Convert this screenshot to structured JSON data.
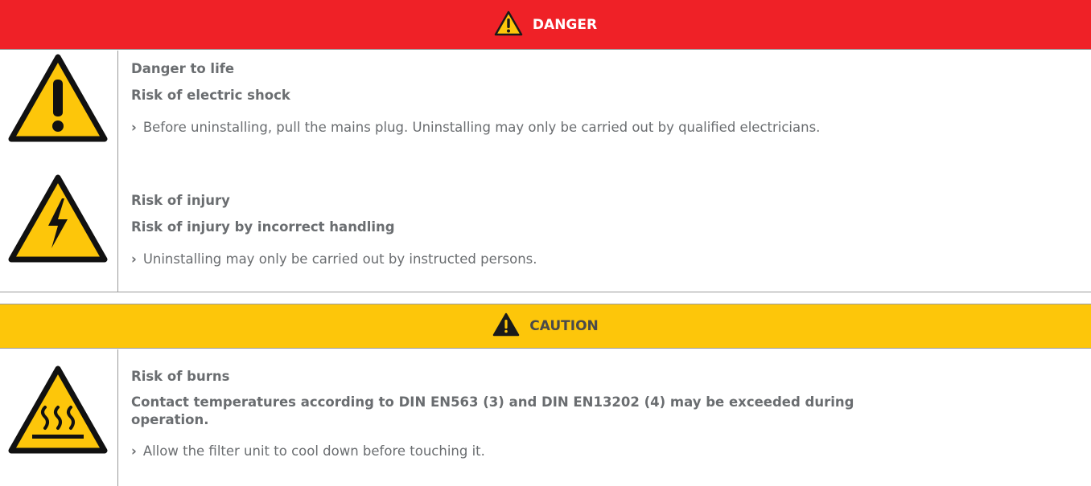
{
  "danger": {
    "header": "DANGER",
    "header_icon": "warning-exclamation-icon",
    "color": "#ef2127",
    "hazards": [
      {
        "symbol": "warning-exclamation-icon",
        "title": "Danger to life",
        "subtitle": "Risk of electric shock",
        "bullet_mark": "›",
        "instruction": "Before uninstalling, pull the mains plug. Uninstalling may only be carried out by qualified electricians."
      },
      {
        "symbol": "electric-shock-icon",
        "title": "Risk of injury",
        "subtitle": "Risk of injury by incorrect handling",
        "bullet_mark": "›",
        "instruction": "Uninstalling may only be carried out by instructed persons."
      }
    ]
  },
  "caution": {
    "header": "CAUTION",
    "header_icon": "warning-exclamation-icon",
    "color": "#fdc60a",
    "hazards": [
      {
        "symbol": "hot-surface-icon",
        "title": "Risk of burns",
        "subtitle_line1": "Contact temperatures according to DIN EN563 (3) and DIN EN13202 (4) may be exceeded during",
        "subtitle_line2": "operation.",
        "bullet_mark": "›",
        "instruction": "Allow the filter unit to cool down before touching it."
      }
    ]
  }
}
